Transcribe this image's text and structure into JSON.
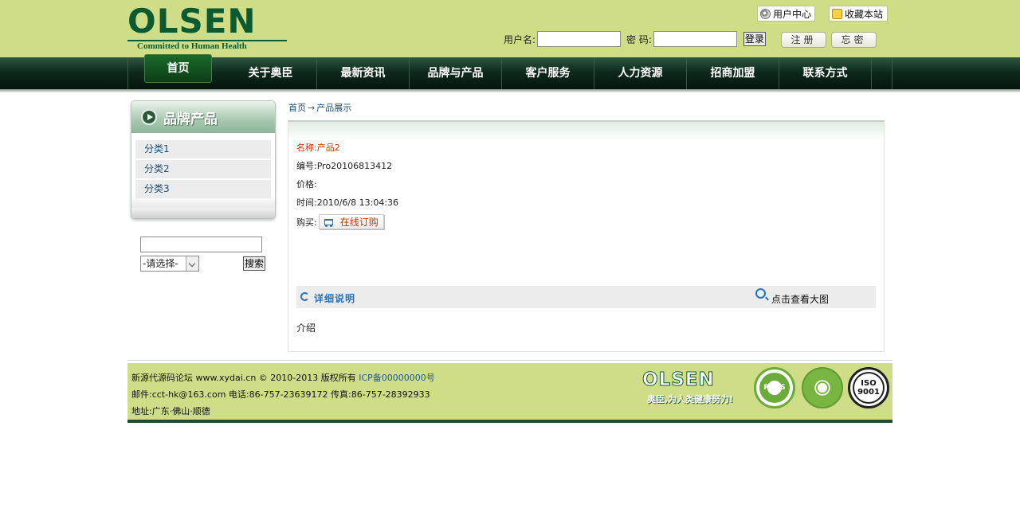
{
  "header": {
    "logo_word": "OLSEN",
    "logo_tagline": "Committed to Human Health",
    "user_center": "用户中心",
    "bookmark": "收藏本站",
    "username_label": "用户名:",
    "password_label": "密 码:",
    "username_value": "",
    "password_value": "",
    "login_button": "登录",
    "register_button": "注册",
    "forgot_button": "忘密"
  },
  "nav": {
    "items": [
      {
        "label": "首页",
        "active": true
      },
      {
        "label": "关于奥臣"
      },
      {
        "label": "最新资讯"
      },
      {
        "label": "品牌与产品"
      },
      {
        "label": "客户服务"
      },
      {
        "label": "人力资源"
      },
      {
        "label": "招商加盟"
      },
      {
        "label": "联系方式"
      }
    ]
  },
  "sidebar": {
    "title": "品牌产品",
    "categories": [
      "分类1",
      "分类2",
      "分类3"
    ],
    "search": {
      "input_value": "",
      "select_value": "-请选择-",
      "button": "搜索"
    }
  },
  "breadcrumb": {
    "home": "首页",
    "separator": "→",
    "current": "产品展示"
  },
  "product": {
    "name_label": "名称:",
    "name": "产品2",
    "code_label": "编号:",
    "code": "Pro20106813412",
    "price_label": "价格:",
    "price": "",
    "time_label": "时间:",
    "time": "2010/6/8 13:04:36",
    "buy_label": "购买:",
    "order_button": "在线订购",
    "detail_title": "详细说明",
    "view_large": "点击查看大图",
    "intro": "介绍"
  },
  "footer": {
    "line1_prefix": "新源代源码论坛 www.xydai.cn © 2010-2013 版权所有 ",
    "icp": "ICP备00000000号",
    "line2": "邮件:cct-hk@163.com 电话:86-757-23639172  传真:86-757-28392933",
    "line3": "地址:广东·佛山·顺德",
    "logo_word": "OLSEN",
    "slogan": "奥臣,为人类健康努力!",
    "cert_rohs": "RoHS",
    "cert_iso": "ISO 9001"
  },
  "colors": {
    "header_bg": "#cfde86",
    "nav_dark": "#04150d",
    "brand_green": "#0c5a32",
    "link_blue": "#1c4f7a",
    "highlight_red": "#cc3300"
  }
}
